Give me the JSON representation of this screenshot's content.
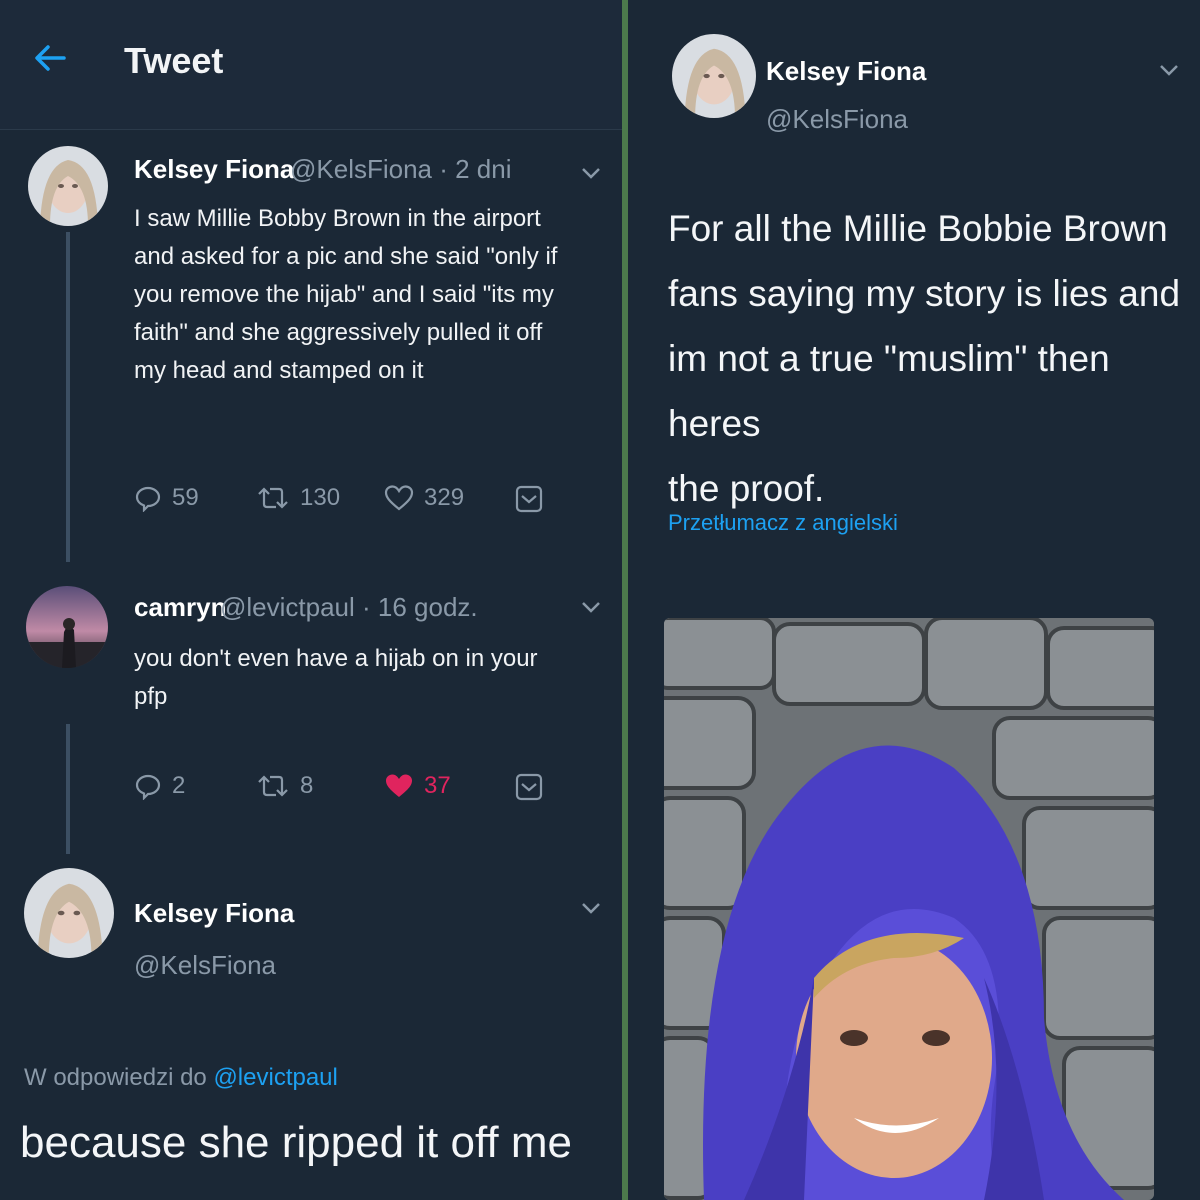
{
  "header": {
    "title": "Tweet"
  },
  "tweet_main": {
    "name": "Kelsey Fiona",
    "handle_time": "@KelsFiona · 2 dni",
    "lines": [
      "I saw Millie Bobby Brown in the airport",
      "and asked for a pic and she said \"only if",
      "you remove the hijab\" and I said \"its my",
      "faith\" and she aggressively pulled it off",
      "my head and stamped on it"
    ],
    "replies": "59",
    "retweets": "130",
    "likes": "329"
  },
  "tweet_reply": {
    "name": "camryn",
    "handle_time": "@levictpaul · 16 godz.",
    "lines": [
      "you don't even have a hijab on in your",
      "pfp"
    ],
    "replies": "2",
    "retweets": "8",
    "likes": "37",
    "liked_color": "#e0245e"
  },
  "tweet_focus": {
    "name": "Kelsey Fiona",
    "handle": "@KelsFiona",
    "reply_prefix": "W odpowiedzi do ",
    "reply_handle": "@levictpaul",
    "text": "because she ripped it off me"
  },
  "right_tweet": {
    "name": "Kelsey Fiona",
    "handle": "@KelsFiona",
    "lines": [
      "For all the Millie Bobbie Brown",
      "fans saying my story is lies and",
      "im not a true \"muslim\" then heres",
      "the proof."
    ],
    "translate_label": "Przetłumacz z angielski"
  },
  "colors": {
    "background": "#1b2836",
    "accent": "#1da1f2",
    "muted": "#8a99a8",
    "divider": "#4c7a4c",
    "like_active": "#e0245e"
  }
}
